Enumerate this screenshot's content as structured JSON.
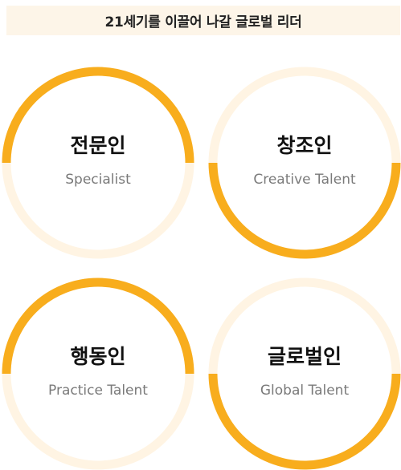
{
  "header": {
    "title": "21세기를 이끌어 나갈 글로벌 리더"
  },
  "colors": {
    "accent": "#f8ad1d",
    "ring_light": "#fff4e3",
    "header_bg": "#fdf5e8",
    "title_text": "#111111",
    "subtitle_text": "#7a7a7a"
  },
  "talents": [
    {
      "title": "전문인",
      "subtitle": "Specialist",
      "highlight": "top"
    },
    {
      "title": "창조인",
      "subtitle": "Creative Talent",
      "highlight": "bottom"
    },
    {
      "title": "행동인",
      "subtitle": "Practice Talent",
      "highlight": "top"
    },
    {
      "title": "글로벌인",
      "subtitle": "Global Talent",
      "highlight": "bottom"
    }
  ]
}
